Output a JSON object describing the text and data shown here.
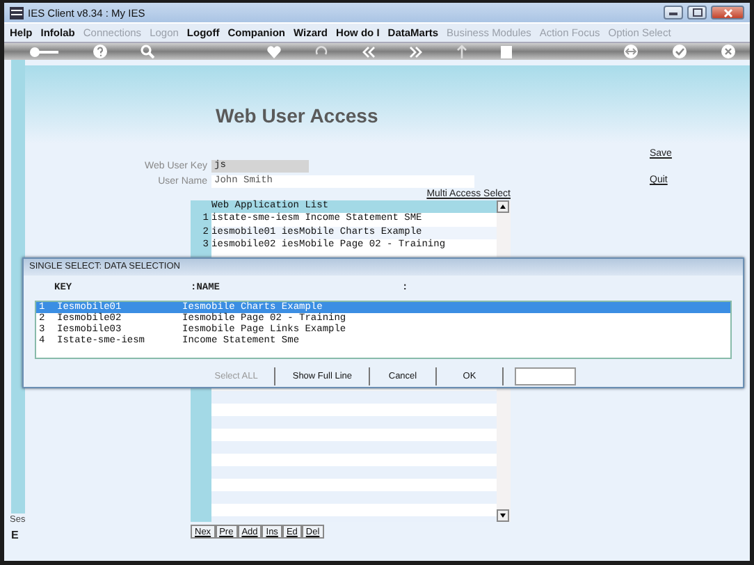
{
  "window": {
    "title": "IES Client v8.34 : My IES"
  },
  "menu": [
    {
      "label": "Help",
      "disabled": false
    },
    {
      "label": "Infolab",
      "disabled": false
    },
    {
      "label": "Connections",
      "disabled": true
    },
    {
      "label": "Logon",
      "disabled": true
    },
    {
      "label": "Logoff",
      "disabled": false
    },
    {
      "label": "Companion",
      "disabled": false
    },
    {
      "label": "Wizard",
      "disabled": false
    },
    {
      "label": "How do I",
      "disabled": false
    },
    {
      "label": "DataMarts",
      "disabled": false
    },
    {
      "label": "Business Modules",
      "disabled": true
    },
    {
      "label": "Action Focus",
      "disabled": true
    },
    {
      "label": "Option Select",
      "disabled": true
    }
  ],
  "page": {
    "title": "Web User Access",
    "fields": [
      {
        "label": "Web User Key",
        "value": "js",
        "kind": "readonly"
      },
      {
        "label": "User Name",
        "value": "John Smith",
        "kind": "text"
      }
    ],
    "actions": [
      "Save",
      "Quit"
    ],
    "multi_access_link": "Multi Access Select",
    "app_list": {
      "heading": "Web Application List",
      "rows": [
        {
          "number": "1",
          "text": "istate-sme-iesm Income Statement SME"
        },
        {
          "number": "2",
          "text": "iesmobile01 iesMobile Charts Example"
        },
        {
          "number": "3",
          "text": "iesmobile02 iesMobile Page 02 - Training"
        }
      ]
    },
    "nav_buttons": [
      "Nex",
      "Pre",
      "Add",
      "Ins",
      "Ed",
      "Del"
    ],
    "side_labels": [
      "Ses",
      "E"
    ]
  },
  "dialog": {
    "title": "SINGLE SELECT: DATA SELECTION",
    "columns": [
      "KEY",
      ":NAME",
      ":"
    ],
    "rows": [
      {
        "number": "1",
        "key": "Iesmobile01",
        "name": "Iesmobile Charts Example",
        "selected": true
      },
      {
        "number": "2",
        "key": "Iesmobile02",
        "name": "Iesmobile Page 02 - Training",
        "selected": false
      },
      {
        "number": "3",
        "key": "Iesmobile03",
        "name": "Iesmobile Page Links Example",
        "selected": false
      },
      {
        "number": "4",
        "key": "Istate-sme-iesm",
        "name": "Income Statement Sme",
        "selected": false
      }
    ],
    "buttons": [
      {
        "label": "Select ALL",
        "disabled": true
      },
      {
        "label": "Show Full Line",
        "disabled": false
      },
      {
        "label": "Cancel",
        "disabled": false
      },
      {
        "label": "OK",
        "disabled": false
      }
    ]
  }
}
